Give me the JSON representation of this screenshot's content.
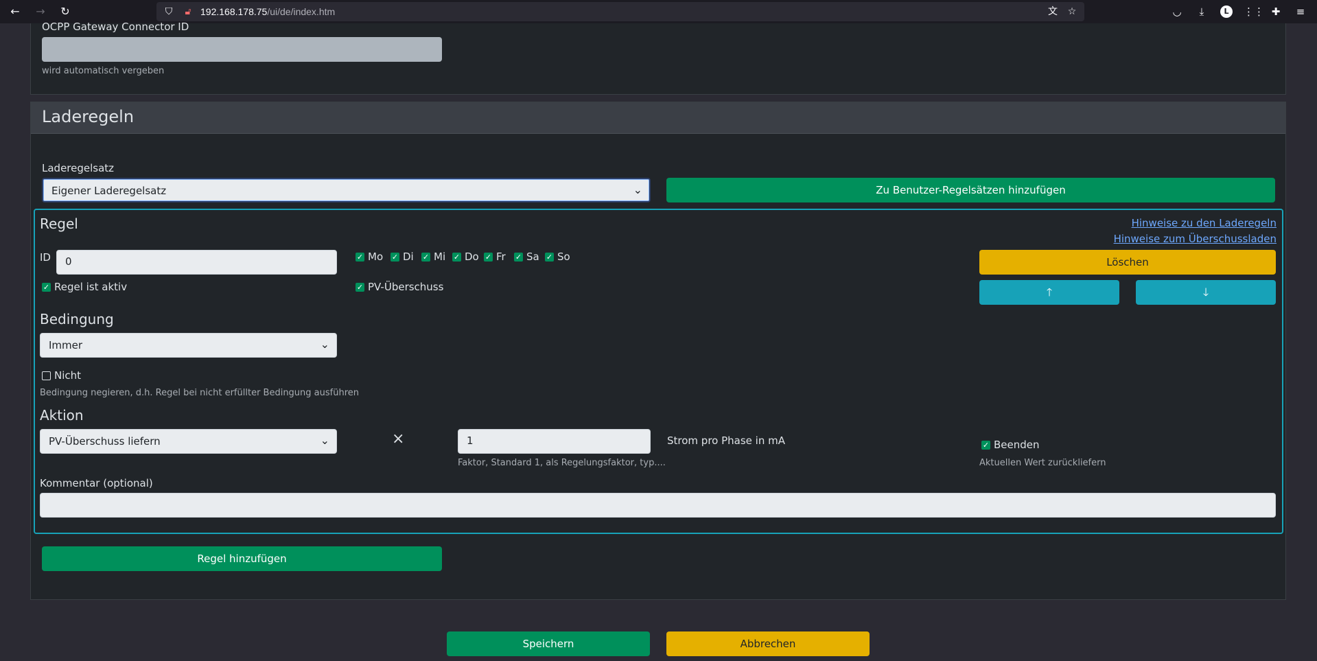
{
  "browser": {
    "url_host": "192.168.178.75",
    "url_path": "/ui/de/index.htm"
  },
  "gateway": {
    "label": "OCPP Gateway Connector ID",
    "value": "",
    "help": "wird automatisch vergeben"
  },
  "section": {
    "title": "Laderegeln",
    "ruleset_label": "Laderegelsatz",
    "ruleset_value": "Eigener Laderegelsatz",
    "add_user_ruleset": "Zu Benutzer-Regelsätzen hinzufügen"
  },
  "rule": {
    "title": "Regel",
    "link_rules": "Hinweise zu den Laderegeln",
    "link_surplus": "Hinweise zum Überschussladen",
    "id_label": "ID",
    "id_value": "0",
    "days": [
      {
        "label": "Mo",
        "checked": true
      },
      {
        "label": "Di",
        "checked": true
      },
      {
        "label": "Mi",
        "checked": true
      },
      {
        "label": "Do",
        "checked": true
      },
      {
        "label": "Fr",
        "checked": true
      },
      {
        "label": "Sa",
        "checked": true
      },
      {
        "label": "So",
        "checked": true
      }
    ],
    "delete": "Löschen",
    "up_icon": "arrow-up",
    "down_icon": "arrow-down",
    "active_label": "Regel ist aktiv",
    "pv_label": "PV-Überschuss",
    "condition_title": "Bedingung",
    "condition_value": "Immer",
    "not_label": "Nicht",
    "not_help": "Bedingung negieren, d.h. Regel bei nicht erfüllter Bedingung ausführen",
    "action_title": "Aktion",
    "action_value": "PV-Überschuss liefern",
    "factor_value": "1",
    "factor_help": "Faktor, Standard 1, als Regelungsfaktor, typ....",
    "unit_text": "Strom pro Phase in mA",
    "end_label": "Beenden",
    "end_help": "Aktuellen Wert zurückliefern",
    "comment_label": "Kommentar (optional)",
    "comment_value": ""
  },
  "add_rule": "Regel hinzufügen",
  "footer": {
    "save": "Speichern",
    "cancel": "Abbrechen"
  },
  "colors": {
    "green": "#00905b",
    "yellow": "#e5b000",
    "teal": "#17a2b8"
  }
}
